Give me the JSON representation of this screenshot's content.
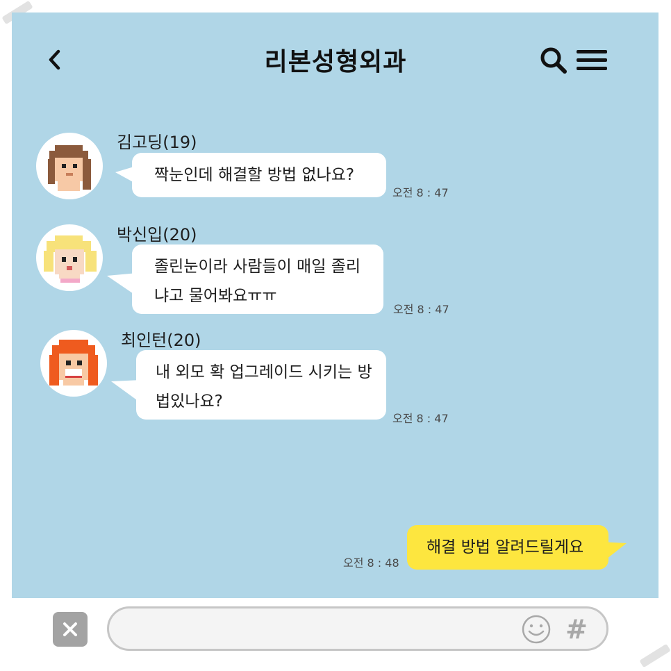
{
  "header": {
    "title": "리본성형외과"
  },
  "messages": [
    {
      "sender": "김고딩(19)",
      "lines": [
        "짝눈인데 해결할 방법 없나요?"
      ],
      "time": "오전 8 : 47",
      "avatar": "brown-hair-girl-avatar"
    },
    {
      "sender": "박신입(20)",
      "lines": [
        "졸린눈이라 사람들이 매일 졸리",
        "냐고 물어봐요ㅠㅠ"
      ],
      "time": "오전 8 : 47",
      "avatar": "blonde-girl-avatar"
    },
    {
      "sender": "최인턴(20)",
      "lines": [
        "내 외모 확 업그레이드 시키는 방",
        "법있나요?"
      ],
      "time": "오전 8 : 47",
      "avatar": "orange-hair-girl-avatar"
    }
  ],
  "reply": {
    "text": "해결 방법 알려드릴게요",
    "time": "오전 8 : 48"
  },
  "input": {
    "value": "",
    "hash_glyph": "#"
  },
  "icons": {
    "back": "chevron-left-icon",
    "search": "search-icon",
    "menu": "hamburger-menu-icon",
    "close": "close-icon",
    "emoji": "smile-icon"
  },
  "colors": {
    "chat_background": "#b0d6e7",
    "incoming_bubble": "#ffffff",
    "outgoing_bubble": "#fde63f",
    "close_button": "#a3a3a3"
  }
}
